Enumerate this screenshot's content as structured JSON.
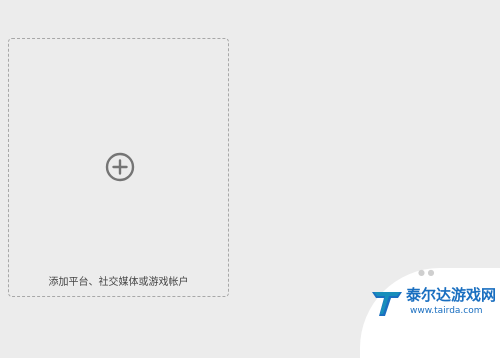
{
  "add_card": {
    "label": "添加平台、社交媒体或游戏帐户",
    "icon": "plus-circle-icon"
  },
  "watermark": {
    "title": "泰尔达游戏网",
    "url": "www.tairda.com",
    "logo": "tairda-logo",
    "colors": {
      "brand_blue": "#1a6fc0",
      "brand_teal": "#17a3b8"
    }
  },
  "colors": {
    "background": "#ececec",
    "card_border": "#a8a8a8",
    "icon": "#757575",
    "text": "#444444"
  }
}
